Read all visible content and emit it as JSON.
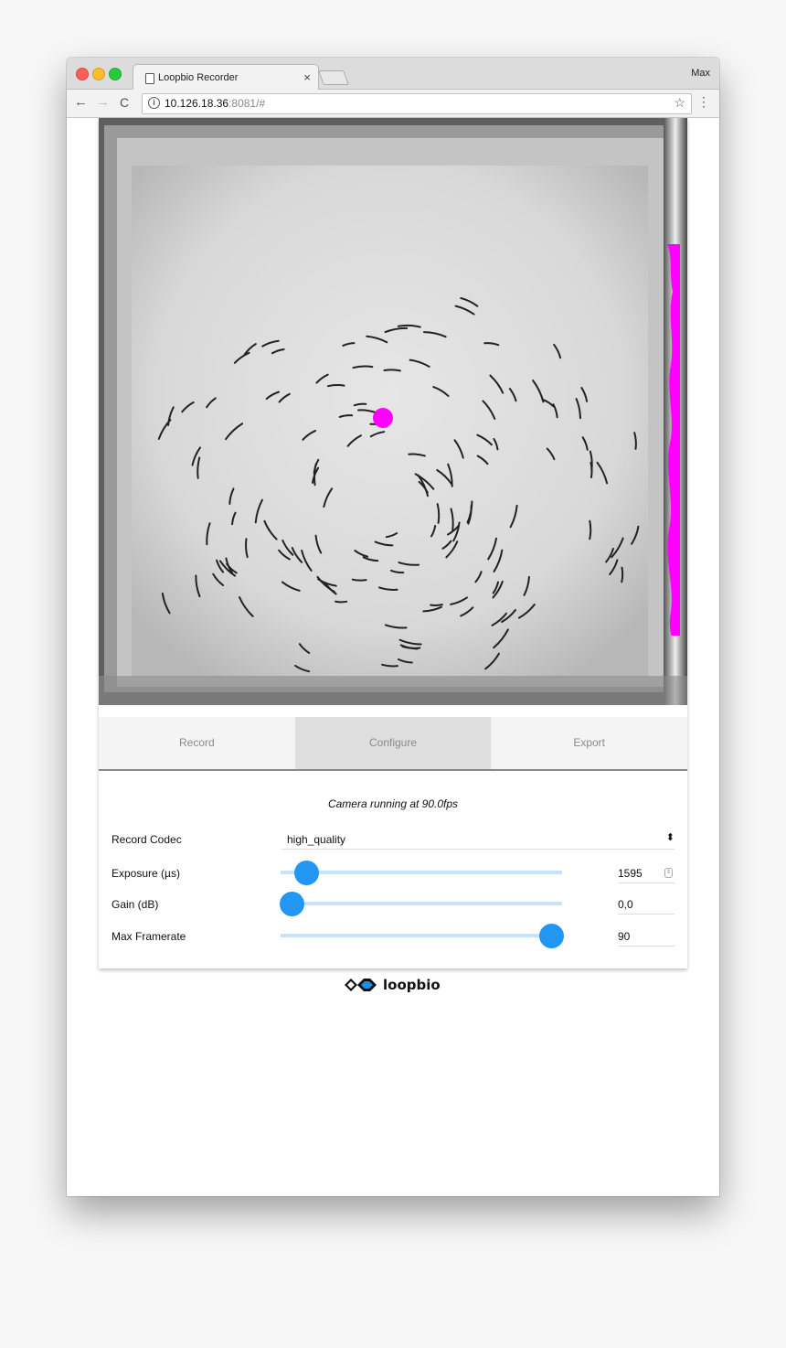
{
  "browser": {
    "tab_title": "Loopbio Recorder",
    "tab_close": "×",
    "profile_name": "Max",
    "url_host": "10.126.18.36",
    "url_rest": ":8081/#",
    "info_icon": "i",
    "back_icon": "←",
    "forward_icon": "→",
    "reload_icon": "C",
    "star_icon": "☆",
    "menu_icon": "⋮"
  },
  "camera": {
    "overlay_color": "#ff00ff",
    "marker_color": "#ff00ff"
  },
  "tabs": [
    {
      "label": "Record",
      "active": false
    },
    {
      "label": "Configure",
      "active": true
    },
    {
      "label": "Export",
      "active": false
    }
  ],
  "configure": {
    "status": "Camera running at 90.0fps",
    "codec": {
      "label": "Record Codec",
      "value": "high_quality",
      "arrow": "⬍"
    },
    "sliders": [
      {
        "label": "Exposure (µs)",
        "value": "1595",
        "fraction": 0.09,
        "spinner": true
      },
      {
        "label": "Gain (dB)",
        "value": "0,0",
        "fraction": 0.04,
        "spinner": false
      },
      {
        "label": "Max Framerate",
        "value": "90",
        "fraction": 0.96,
        "spinner": false
      }
    ]
  },
  "footer": {
    "logo_text": "loopbio"
  },
  "accent_color": "#2196f3"
}
